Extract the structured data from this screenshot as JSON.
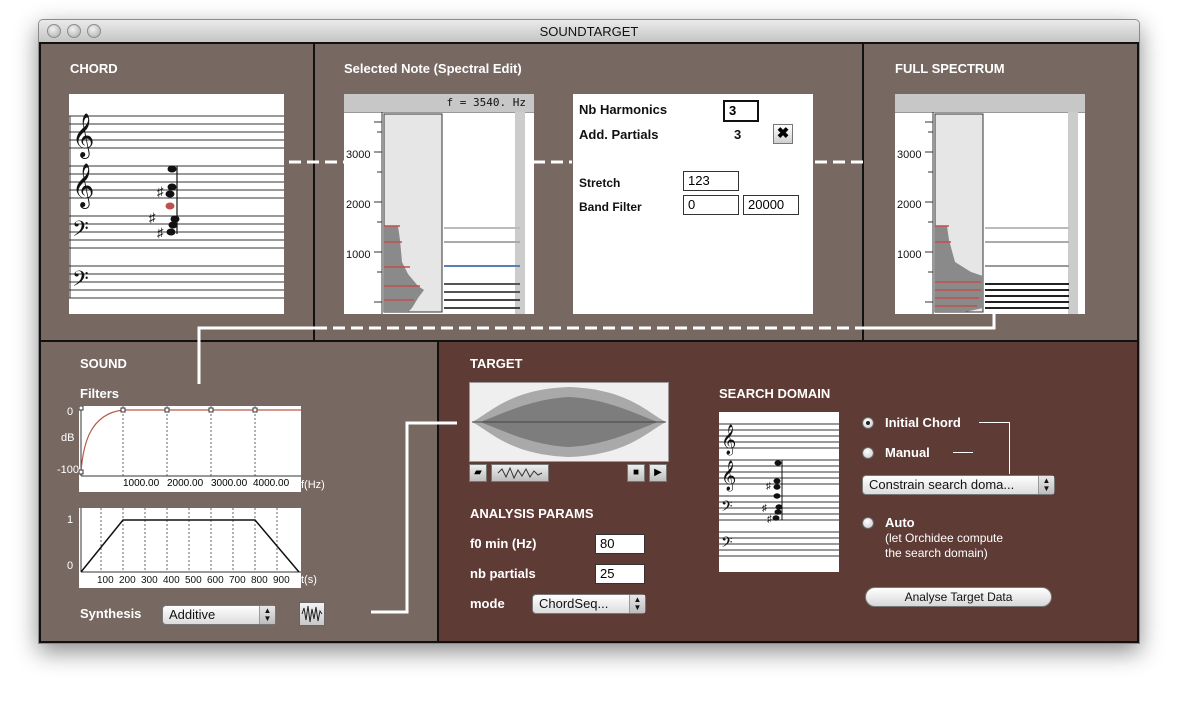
{
  "window": {
    "title": "SOUNDTARGET"
  },
  "chord": {
    "header": "CHORD"
  },
  "selected_note": {
    "header": "Selected Note (Spectral Edit)",
    "freq_display": "f = 3540. Hz",
    "axis_ticks": [
      "3000",
      "2000",
      "1000"
    ],
    "nb_harmonics_label": "Nb Harmonics",
    "nb_harmonics_value": "3",
    "add_partials_label": "Add. Partials",
    "add_partials_value": "3",
    "stretch_label": "Stretch",
    "stretch_value": "123",
    "band_filter_label": "Band Filter",
    "band_filter_low": "0",
    "band_filter_high": "20000"
  },
  "full_spectrum": {
    "header": "FULL SPECTRUM",
    "axis_ticks": [
      "3000",
      "2000",
      "1000"
    ]
  },
  "sound": {
    "header": "SOUND",
    "filters_label": "Filters",
    "filter_y_labels": [
      "0",
      "dB",
      "-100"
    ],
    "filter_x_labels": [
      "1000.00",
      "2000.00",
      "3000.00",
      "4000.00"
    ],
    "filter_x_unit": "f(Hz)",
    "env_y_labels": [
      "1",
      "0"
    ],
    "env_x_labels": [
      "100",
      "200",
      "300",
      "400",
      "500",
      "600",
      "700",
      "800",
      "900"
    ],
    "env_x_unit": "t(s)",
    "synthesis_label": "Synthesis",
    "synthesis_value": "Additive"
  },
  "target": {
    "header": "TARGET",
    "analysis_header": "ANALYSIS PARAMS",
    "f0_label": "f0 min (Hz)",
    "f0_value": "80",
    "nb_partials_label": "nb partials",
    "nb_partials_value": "25",
    "mode_label": "mode",
    "mode_value": "ChordSeq...",
    "search_domain_header": "SEARCH DOMAIN",
    "radio_initial": "Initial Chord",
    "radio_manual": "Manual",
    "constrain_value": "Constrain search doma...",
    "radio_auto": "Auto",
    "auto_note_line1": "(let Orchidee compute",
    "auto_note_line2": "the search domain)",
    "analyse_button": "Analyse Target Data"
  },
  "colors": {
    "panel_brown": "#776862",
    "panel_dark": "#5f3b36",
    "partial_red": "#c0504d",
    "partial_blue": "#5b7fb5"
  }
}
